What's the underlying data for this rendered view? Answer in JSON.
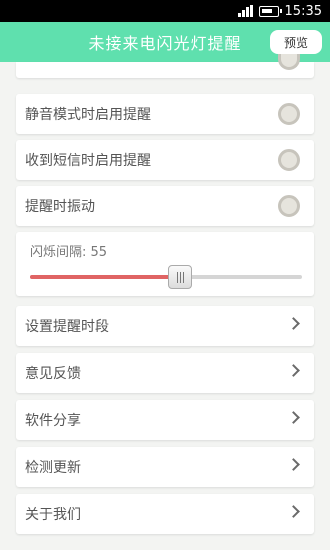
{
  "status_bar": {
    "time": "15:35"
  },
  "app": {
    "title": "未接来电闪光灯提醒",
    "preview_label": "预览"
  },
  "toggles": [
    {
      "label": "静音模式时启用提醒"
    },
    {
      "label": "收到短信时启用提醒"
    },
    {
      "label": "提醒时振动"
    }
  ],
  "flash_interval": {
    "label": "闪烁间隔: 55",
    "fraction": 0.55
  },
  "menu": [
    {
      "label": "设置提醒时段"
    },
    {
      "label": "意见反馈"
    },
    {
      "label": "软件分享"
    },
    {
      "label": "检测更新"
    },
    {
      "label": "关于我们"
    }
  ],
  "colors": {
    "accent": "#5fe0ae",
    "slider_fill": "#e06464"
  },
  "icons": [
    "signal-icon",
    "battery-icon",
    "radio-icon",
    "chevron-right-icon",
    "slider-thumb"
  ]
}
